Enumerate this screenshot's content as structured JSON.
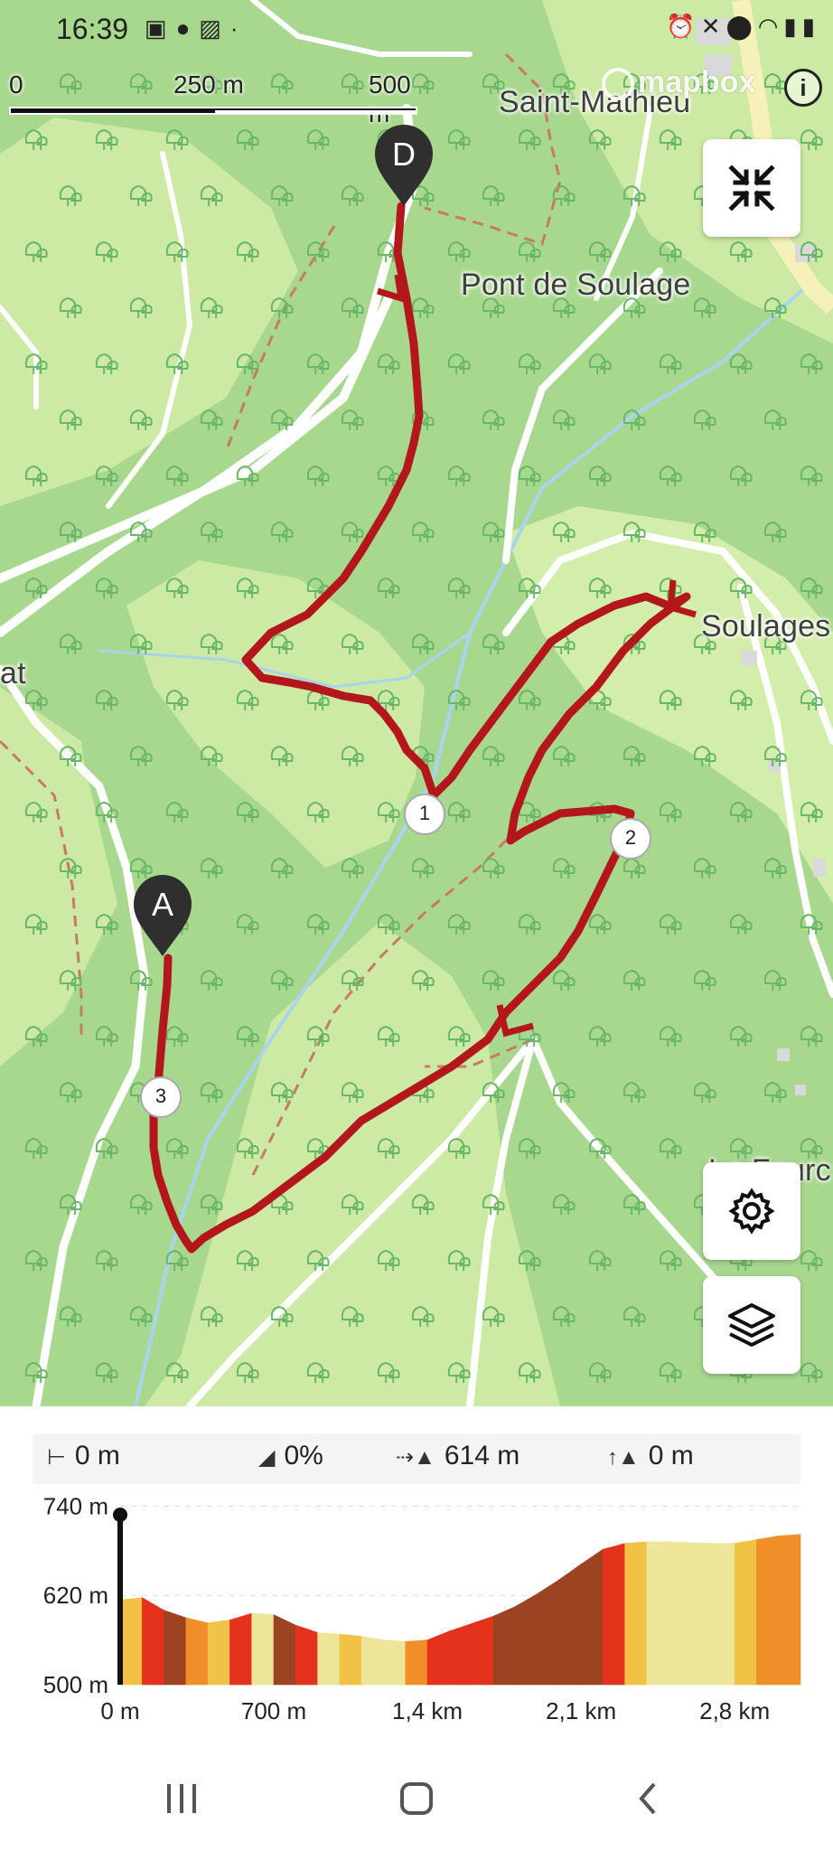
{
  "status_bar": {
    "time": "16:39",
    "left_icons": [
      "sim-icon",
      "app-icon",
      "image-icon",
      "dot-icon"
    ],
    "right_icons": [
      "alarm-icon",
      "mute-icon",
      "location-icon",
      "wifi-icon",
      "signal-icon",
      "battery-icon"
    ]
  },
  "map": {
    "scale": {
      "label_start": "0",
      "label_mid": "250 m",
      "label_end": "500 m"
    },
    "attribution": "mapbox",
    "place_labels": {
      "saint_mathieu": "Saint-Mathieu",
      "pont_de_soulage": "Pont de Soulage",
      "soulages": "Soulages",
      "left_partial": "at",
      "bottom_right_partial": "Le Fourc"
    },
    "markers": {
      "start": "A",
      "end": "D",
      "waypoint_1": "1",
      "waypoint_2": "2",
      "waypoint_3": "3"
    },
    "colors": {
      "route": "#b3161b",
      "forest": "#a8d88e",
      "meadow": "#cdeaa4",
      "water": "#a9d4ef",
      "road": "#ffffff"
    }
  },
  "buttons": {
    "collapse": "collapse-icon",
    "settings": "gear-icon",
    "layers": "layers-icon"
  },
  "stats": {
    "distance": "0 m",
    "slope": "0%",
    "altitude": "614 m",
    "ascent": "0 m"
  },
  "chart_data": {
    "type": "area",
    "title": "",
    "xlabel": "",
    "ylabel": "",
    "y_ticks": [
      "740 m",
      "620 m",
      "500 m"
    ],
    "x_ticks": [
      "0 m",
      "700 m",
      "1,4 km",
      "2,1 km",
      "2,8 km"
    ],
    "x_km": [
      0,
      0.1,
      0.2,
      0.3,
      0.4,
      0.5,
      0.6,
      0.7,
      0.8,
      0.9,
      1.0,
      1.1,
      1.2,
      1.3,
      1.4,
      1.5,
      1.6,
      1.7,
      1.8,
      1.9,
      2.0,
      2.1,
      2.2,
      2.3,
      2.4,
      2.5,
      2.6,
      2.7,
      2.8,
      2.9,
      3.0,
      3.1
    ],
    "elevation_m": [
      614,
      617,
      600,
      590,
      583,
      587,
      596,
      594,
      580,
      570,
      568,
      565,
      560,
      558,
      560,
      572,
      582,
      592,
      605,
      622,
      641,
      662,
      682,
      690,
      692,
      692,
      691,
      690,
      690,
      695,
      700,
      702
    ],
    "segment_colors": [
      "#f2c246",
      "#e5321c",
      "#9c4322",
      "#f08f2a",
      "#f2c246",
      "#e5321c",
      "#ede597",
      "#9c4322",
      "#e5321c",
      "#ede597",
      "#f2c246",
      "#ede597",
      "#ede597",
      "#f08f2a",
      "#e5321c",
      "#e5321c",
      "#e5321c",
      "#9c4322",
      "#9c4322",
      "#9c4322",
      "#9c4322",
      "#9c4322",
      "#e5321c",
      "#f2c246",
      "#ede597",
      "#ede597",
      "#ede597",
      "#ede597",
      "#f2c246",
      "#f08f2a",
      "#f08f2a"
    ],
    "ylim": [
      500,
      760
    ],
    "xlim": [
      0,
      3.1
    ],
    "grid": true,
    "cursor_x_km": 0
  },
  "nav": {
    "recents": "recents-icon",
    "home": "home-icon",
    "back": "back-icon"
  }
}
